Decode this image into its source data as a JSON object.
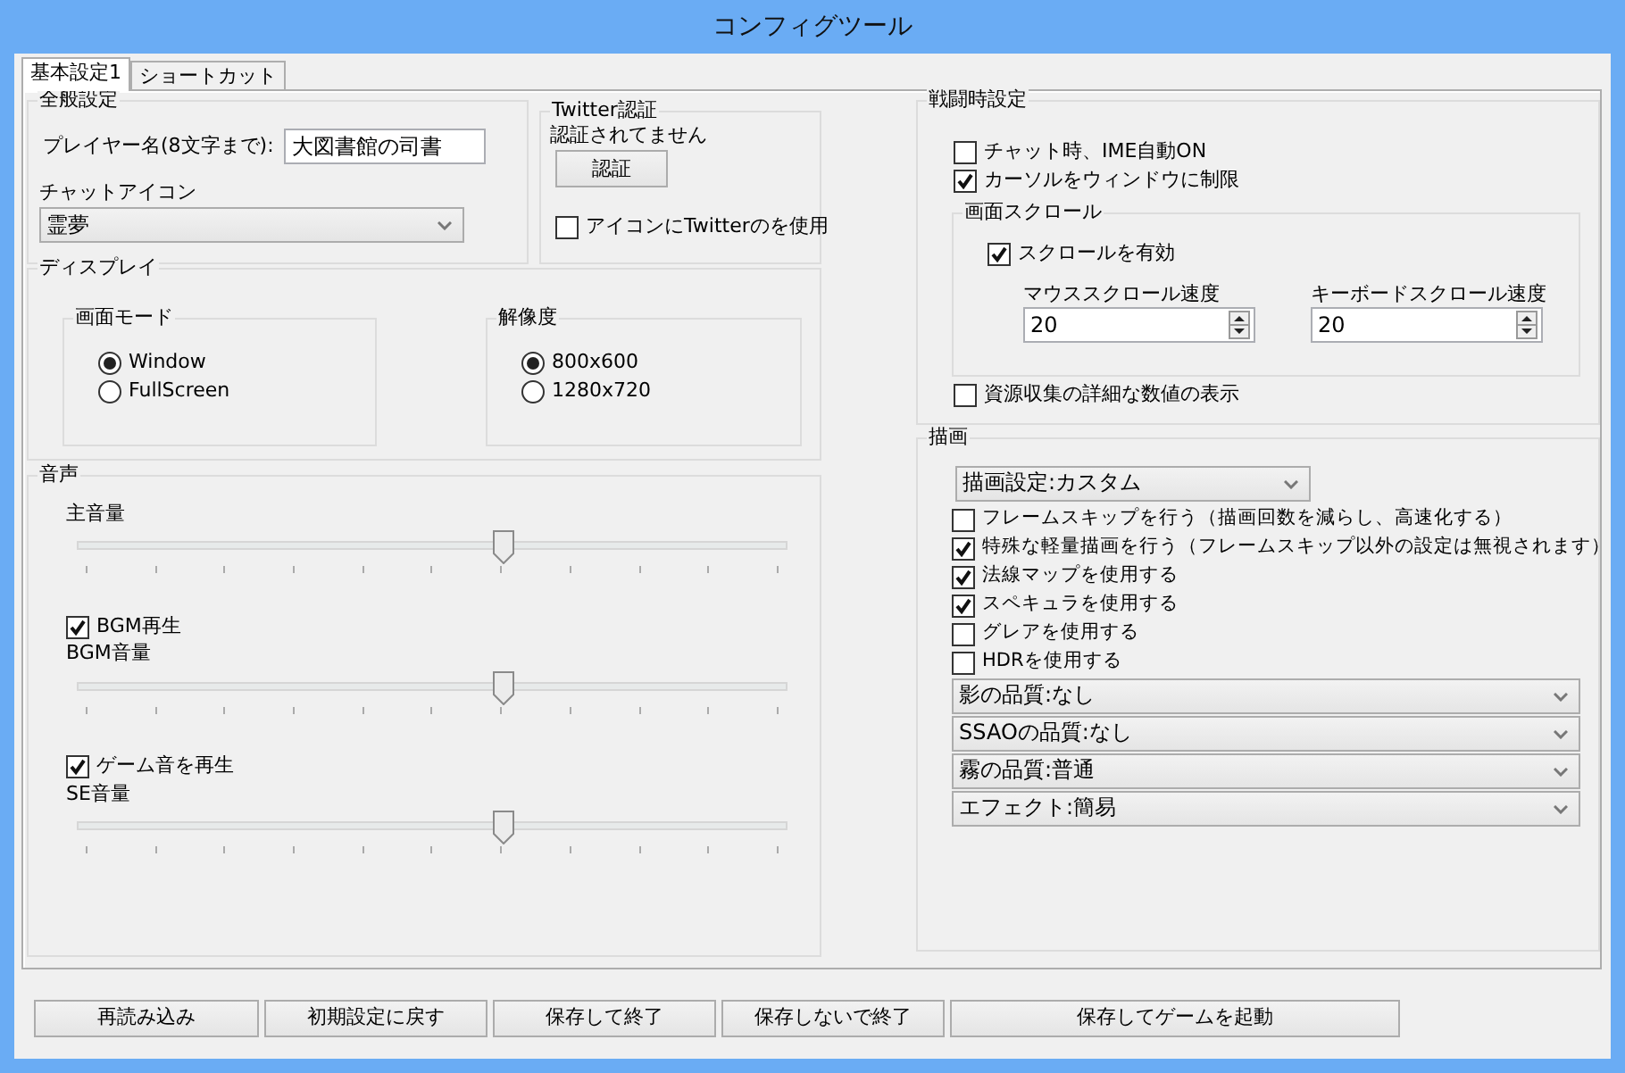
{
  "window": {
    "title": "コンフィグツール"
  },
  "tabs": [
    {
      "label": "基本設定1",
      "selected": true
    },
    {
      "label": "ショートカット",
      "selected": false
    }
  ],
  "general": {
    "title": "全般設定",
    "player_name_label": "プレイヤー名(8文字まで):",
    "player_name": "大図書館の司書",
    "chat_icon_label": "チャットアイコン",
    "chat_icon": "霊夢"
  },
  "twitter": {
    "title": "Twitter認証",
    "status": "認証されてません",
    "button": "認証",
    "use_icon": {
      "label": "アイコンにTwitterのを使用",
      "checked": false
    }
  },
  "display": {
    "title": "ディスプレイ",
    "groups": [
      {
        "title": "画面モード",
        "options": [
          {
            "label": "Window",
            "selected": true
          },
          {
            "label": "FullScreen",
            "selected": false
          }
        ]
      },
      {
        "title": "解像度",
        "options": [
          {
            "label": "800x600",
            "selected": true
          },
          {
            "label": "1280x720",
            "selected": false
          }
        ]
      }
    ]
  },
  "sound": {
    "title": "音声",
    "items": [
      {
        "kind": "slider",
        "label": "主音量",
        "level": 0.6
      },
      {
        "kind": "checkbox",
        "label": "BGM再生",
        "checked": true
      },
      {
        "kind": "slider",
        "label": "BGM音量",
        "level": 0.6
      },
      {
        "kind": "checkbox",
        "label": "ゲーム音を再生",
        "checked": true
      },
      {
        "kind": "slider",
        "label": "SE音量",
        "level": 0.6
      }
    ]
  },
  "battle": {
    "title": "戦闘時設定",
    "checks": [
      {
        "label": "チャット時、IME自動ON",
        "checked": false
      },
      {
        "label": "カーソルをウィンドウに制限",
        "checked": true
      }
    ],
    "scroll": {
      "title": "画面スクロール",
      "enable": {
        "label": "スクロールを有効",
        "checked": true
      },
      "fields": [
        {
          "label": "マウススクロール速度",
          "value": "20"
        },
        {
          "label": "キーボードスクロール速度",
          "value": "20"
        }
      ]
    },
    "after": [
      {
        "label": "資源収集の詳細な数値の表示",
        "checked": false
      }
    ]
  },
  "render": {
    "title": "描画",
    "items": [
      {
        "kind": "select",
        "value": "描画設定:カスタム"
      },
      {
        "kind": "checkbox",
        "label": "フレームスキップを行う（描画回数を減らし、高速化する）",
        "checked": false
      },
      {
        "kind": "checkbox",
        "label": "特殊な軽量描画を行う（フレームスキップ以外の設定は無視されます）",
        "checked": true
      },
      {
        "kind": "checkbox",
        "label": "法線マップを使用する",
        "checked": true
      },
      {
        "kind": "checkbox",
        "label": "スペキュラを使用する",
        "checked": true
      },
      {
        "kind": "checkbox",
        "label": "グレアを使用する",
        "checked": false
      },
      {
        "kind": "checkbox",
        "label": "HDRを使用する",
        "checked": false
      },
      {
        "kind": "wideselect",
        "value": "影の品質:なし"
      },
      {
        "kind": "wideselect",
        "value": "SSAOの品質:なし"
      },
      {
        "kind": "wideselect",
        "value": "霧の品質:普通"
      },
      {
        "kind": "wideselect",
        "value": "エフェクト:簡易"
      }
    ]
  },
  "buttons": [
    "再読み込み",
    "初期設定に戻す",
    "保存して終了",
    "保存しないで終了",
    "保存してゲームを起動"
  ]
}
